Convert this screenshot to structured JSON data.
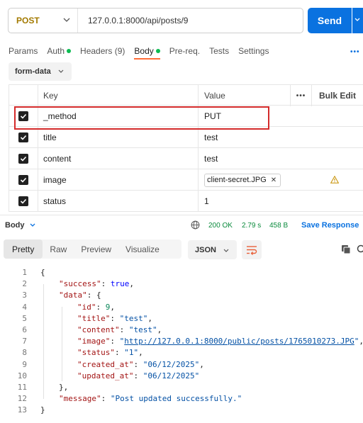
{
  "request": {
    "method": "POST",
    "url": "127.0.0.1:8000/api/posts/9",
    "send_label": "Send"
  },
  "tabs": [
    {
      "label": "Params",
      "active": false,
      "dot": false
    },
    {
      "label": "Auth",
      "active": false,
      "dot": true
    },
    {
      "label": "Headers (9)",
      "active": false,
      "dot": false
    },
    {
      "label": "Body",
      "active": true,
      "dot": true
    },
    {
      "label": "Pre-req.",
      "active": false,
      "dot": false
    },
    {
      "label": "Tests",
      "active": false,
      "dot": false
    },
    {
      "label": "Settings",
      "active": false,
      "dot": false
    }
  ],
  "more_dots": "•••",
  "body_type": "form-data",
  "table": {
    "headers": {
      "key": "Key",
      "value": "Value",
      "more": "•••",
      "bulk": "Bulk Edit"
    },
    "rows": [
      {
        "checked": true,
        "key": "_method",
        "value": "PUT"
      },
      {
        "checked": true,
        "key": "title",
        "value": "test"
      },
      {
        "checked": true,
        "key": "content",
        "value": "test"
      },
      {
        "checked": true,
        "key": "image",
        "value": "client-secret.JPG",
        "file": true,
        "warning": true
      },
      {
        "checked": true,
        "key": "status",
        "value": "1"
      }
    ]
  },
  "response": {
    "body_label": "Body",
    "status": "200 OK",
    "time": "2.79 s",
    "size": "458 B",
    "save_label": "Save Response"
  },
  "view_tabs": [
    {
      "label": "Pretty",
      "active": true
    },
    {
      "label": "Raw",
      "active": false
    },
    {
      "label": "Preview",
      "active": false
    },
    {
      "label": "Visualize",
      "active": false
    }
  ],
  "format": "JSON",
  "code_lines": [
    {
      "n": "1",
      "indent": 0,
      "parts": [
        [
          "p",
          "{"
        ]
      ]
    },
    {
      "n": "2",
      "indent": 1,
      "parts": [
        [
          "k",
          "\"success\""
        ],
        [
          "p",
          ": "
        ],
        [
          "b",
          "true"
        ],
        [
          "p",
          ","
        ]
      ]
    },
    {
      "n": "3",
      "indent": 1,
      "parts": [
        [
          "k",
          "\"data\""
        ],
        [
          "p",
          ": {"
        ]
      ]
    },
    {
      "n": "4",
      "indent": 2,
      "parts": [
        [
          "k",
          "\"id\""
        ],
        [
          "p",
          ": "
        ],
        [
          "n",
          "9"
        ],
        [
          "p",
          ","
        ]
      ]
    },
    {
      "n": "5",
      "indent": 2,
      "parts": [
        [
          "k",
          "\"title\""
        ],
        [
          "p",
          ": "
        ],
        [
          "s",
          "\"test\""
        ],
        [
          "p",
          ","
        ]
      ]
    },
    {
      "n": "6",
      "indent": 2,
      "parts": [
        [
          "k",
          "\"content\""
        ],
        [
          "p",
          ": "
        ],
        [
          "s",
          "\"test\""
        ],
        [
          "p",
          ","
        ]
      ]
    },
    {
      "n": "7",
      "indent": 2,
      "parts": [
        [
          "k",
          "\"image\""
        ],
        [
          "p",
          ": "
        ],
        [
          "s",
          "\""
        ],
        [
          "u",
          "http://127.0.0.1:8000/public/posts/1765010273.JPG"
        ],
        [
          "s",
          "\""
        ],
        [
          "p",
          ","
        ]
      ]
    },
    {
      "n": "8",
      "indent": 2,
      "parts": [
        [
          "k",
          "\"status\""
        ],
        [
          "p",
          ": "
        ],
        [
          "s",
          "\"1\""
        ],
        [
          "p",
          ","
        ]
      ]
    },
    {
      "n": "9",
      "indent": 2,
      "parts": [
        [
          "k",
          "\"created_at\""
        ],
        [
          "p",
          ": "
        ],
        [
          "s",
          "\"06/12/2025\""
        ],
        [
          "p",
          ","
        ]
      ]
    },
    {
      "n": "10",
      "indent": 2,
      "parts": [
        [
          "k",
          "\"updated_at\""
        ],
        [
          "p",
          ": "
        ],
        [
          "s",
          "\"06/12/2025\""
        ]
      ]
    },
    {
      "n": "11",
      "indent": 1,
      "parts": [
        [
          "p",
          "},"
        ]
      ]
    },
    {
      "n": "12",
      "indent": 1,
      "parts": [
        [
          "k",
          "\"message\""
        ],
        [
          "p",
          ": "
        ],
        [
          "s",
          "\"Post updated successfully.\""
        ]
      ]
    },
    {
      "n": "13",
      "indent": 0,
      "parts": [
        [
          "p",
          "}"
        ]
      ]
    }
  ]
}
